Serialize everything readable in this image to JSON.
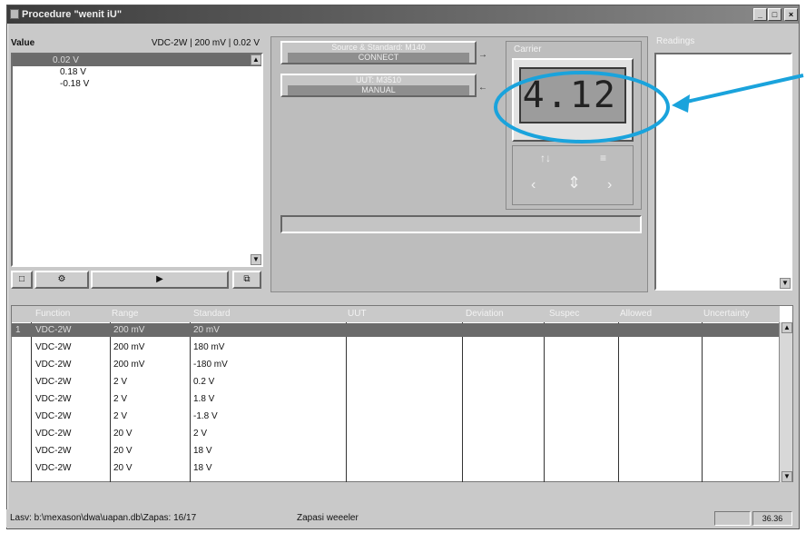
{
  "window": {
    "title": "Procedure \"wenit iU\"",
    "min_glyph": "_",
    "max_glyph": "□",
    "close_glyph": "×"
  },
  "values": {
    "label": "Value",
    "range_text": "VDC-2W | 200 mV | 0.02 V",
    "items": [
      "0.02 V",
      "0.18 V",
      "-0.18 V"
    ],
    "selected_index": 0,
    "scroll_up": "▲",
    "scroll_down": "▼",
    "toolbar": {
      "new": "□",
      "config": "⚙",
      "run": "▶",
      "copy": "⧉"
    }
  },
  "center": {
    "source_btn": {
      "top": "Source & Standard: M140",
      "bottom": "CONNECT"
    },
    "uut_btn": {
      "top": "UUT: M3510",
      "bottom": "MANUAL"
    },
    "arrow1": "→",
    "arrow2": "←"
  },
  "carrier": {
    "label": "Carrier",
    "display": "4.12",
    "row1_left": "↑↓",
    "row1_right": "≡",
    "nav_left": "‹",
    "nav_center": "⇕",
    "nav_right": "›"
  },
  "readings": {
    "label": "Readings",
    "scroll_down": "▼"
  },
  "grid": {
    "columns": [
      "Function",
      "Range",
      "Standard",
      "UUT",
      "Deviation",
      "Suspec",
      "Allowed",
      "Uncertainty"
    ],
    "rows": [
      {
        "num": "1",
        "function": "VDC-2W",
        "range": "200 mV",
        "standard": "20 mV"
      },
      {
        "num": "",
        "function": "VDC-2W",
        "range": "200 mV",
        "standard": "180 mV"
      },
      {
        "num": "",
        "function": "VDC-2W",
        "range": "200 mV",
        "standard": "-180 mV"
      },
      {
        "num": "",
        "function": "VDC-2W",
        "range": "2 V",
        "standard": "0.2 V"
      },
      {
        "num": "",
        "function": "VDC-2W",
        "range": "2 V",
        "standard": "1.8 V"
      },
      {
        "num": "",
        "function": "VDC-2W",
        "range": "2 V",
        "standard": "-1.8 V"
      },
      {
        "num": "",
        "function": "VDC-2W",
        "range": "20 V",
        "standard": "2 V"
      },
      {
        "num": "",
        "function": "VDC-2W",
        "range": "20 V",
        "standard": "18 V"
      },
      {
        "num": "",
        "function": "VDC-2W",
        "range": "20 V",
        "standard": "18 V"
      }
    ],
    "scroll_up": "▲",
    "scroll_down": "▼"
  },
  "status": {
    "path": "Lasv: b:\\mexason\\dwa\\uapan.db\\Zapas: 16/17",
    "state": "Zapasi weeeler",
    "box2": "36.36"
  },
  "annotation_color": "#1aa3dc"
}
